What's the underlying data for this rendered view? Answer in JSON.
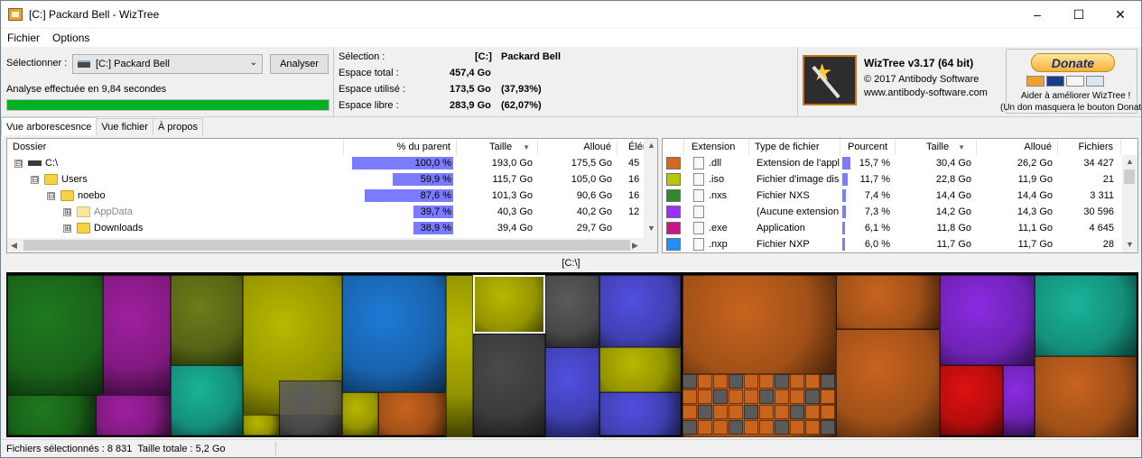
{
  "window": {
    "title": "[C:] Packard Bell  - WizTree",
    "minimize_glyph": "–",
    "maximize_glyph": "☐",
    "close_glyph": "✕"
  },
  "menu": {
    "file": "Fichier",
    "options": "Options"
  },
  "select": {
    "label": "Sélectionner :",
    "drive_value": "[C:] Packard Bell",
    "analyze_button": "Analyser",
    "analysis_status": "Analyse effectuée en 9,84 secondes",
    "progress_fraction": 1.0
  },
  "summary": {
    "selection_label": "Sélection :",
    "selection_drive": "[C:]",
    "selection_name": "Packard Bell",
    "total_label": "Espace total :",
    "total_value": "457,4 Go",
    "used_label": "Espace utilisé :",
    "used_value": "173,5 Go",
    "used_pct": "(37,93%)",
    "free_label": "Espace libre :",
    "free_value": "283,9 Go",
    "free_pct": "(62,07%)"
  },
  "about": {
    "product": "WizTree v3.17 (64 bit)",
    "copyright": "© 2017 Antibody Software",
    "website": "www.antibody-software.com"
  },
  "donate": {
    "button": "Donate",
    "help_text": "Aider à améliorer WizTree !",
    "note": "(Un don masquera le bouton Donate)",
    "card_labels": [
      "VISA",
      "DISCOVER",
      "BANK"
    ]
  },
  "tabs": [
    "Vue arborescesnce",
    "Vue fichier",
    "À propos"
  ],
  "tree": {
    "headers": [
      "Dossier",
      "% du parent",
      "Taille",
      "Alloué",
      "Élémen"
    ],
    "rows": [
      {
        "name": "C:\\",
        "pct": "100,0 %",
        "pct_value": 100.0,
        "size": "193,0 Go",
        "alloc": "175,5 Go",
        "items": "45",
        "expander": "⊟",
        "dim": false
      },
      {
        "name": "Users",
        "pct": "59,9 %",
        "pct_value": 59.9,
        "size": "115,7 Go",
        "alloc": "105,0 Go",
        "items": "16",
        "expander": "⊟",
        "dim": false
      },
      {
        "name": "noebo",
        "pct": "87,6 %",
        "pct_value": 87.6,
        "size": "101,3 Go",
        "alloc": "90,6 Go",
        "items": "16",
        "expander": "⊟",
        "dim": false
      },
      {
        "name": "AppData",
        "pct": "39,7 %",
        "pct_value": 39.7,
        "size": "40,3 Go",
        "alloc": "40,2 Go",
        "items": "12",
        "expander": "⊞",
        "dim": true
      },
      {
        "name": "Downloads",
        "pct": "38,9 %",
        "pct_value": 38.9,
        "size": "39,4 Go",
        "alloc": "29,7 Go",
        "items": "",
        "expander": "⊞",
        "dim": false
      }
    ]
  },
  "extensions": {
    "headers": [
      "Extension",
      "Type de fichier",
      "Pourcent",
      "Taille",
      "Alloué",
      "Fichiers"
    ],
    "rows": [
      {
        "color": "#d2691e",
        "ext": ".dll",
        "type": "Extension de l'appl",
        "pct": "15,7 %",
        "pct_value": 15.7,
        "size": "30,4 Go",
        "alloc": "26,2 Go",
        "files": "34 427"
      },
      {
        "color": "#b5c800",
        "ext": ".iso",
        "type": "Fichier d'image disq",
        "pct": "11,7 %",
        "pct_value": 11.7,
        "size": "22,8 Go",
        "alloc": "11,9 Go",
        "files": "21"
      },
      {
        "color": "#2e8b2e",
        "ext": ".nxs",
        "type": "Fichier NXS",
        "pct": "7,4 %",
        "pct_value": 7.4,
        "size": "14,4 Go",
        "alloc": "14,4 Go",
        "files": "3 311"
      },
      {
        "color": "#9b30ff",
        "ext": "",
        "type": "(Aucune extension",
        "pct": "7,3 %",
        "pct_value": 7.3,
        "size": "14,2 Go",
        "alloc": "14,3 Go",
        "files": "30 596"
      },
      {
        "color": "#c71585",
        "ext": ".exe",
        "type": "Application",
        "pct": "6,1 %",
        "pct_value": 6.1,
        "size": "11,8 Go",
        "alloc": "11,1 Go",
        "files": "4 645"
      },
      {
        "color": "#1e90ff",
        "ext": ".nxp",
        "type": "Fichier NXP",
        "pct": "6,0 %",
        "pct_value": 6.0,
        "size": "11,7 Go",
        "alloc": "11,7 Go",
        "files": "28"
      }
    ]
  },
  "treemap": {
    "title": "[C:\\]",
    "palette": [
      "#1f7a1f",
      "#a020a0",
      "#6b7d1a",
      "#b8b800",
      "#1e7ad6",
      "#4a4a4a",
      "#5050e0",
      "#c8641e",
      "#8a2be2",
      "#e01010",
      "#19b399",
      "#5a5a5a",
      "#3cb371"
    ]
  },
  "status": {
    "selected": "Fichiers sélectionnés : 8 831",
    "total": "Taille totale : 5,2 Go"
  }
}
